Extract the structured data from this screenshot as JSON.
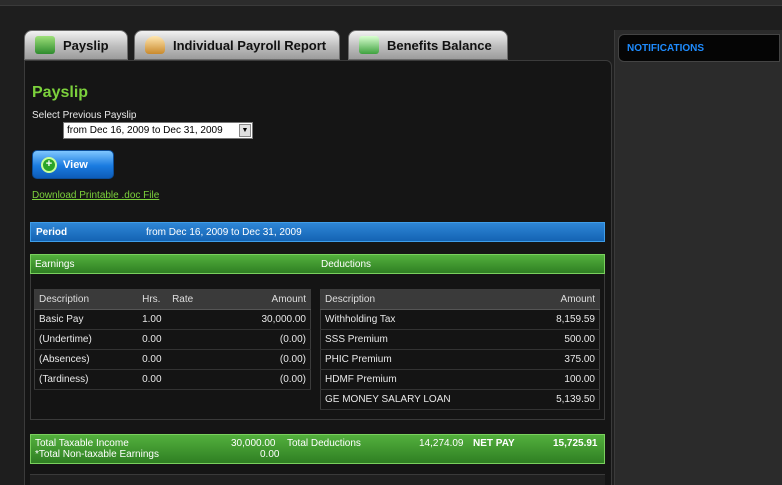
{
  "tabs": [
    {
      "label": "Payslip",
      "icon": "money-icon"
    },
    {
      "label": "Individual Payroll Report",
      "icon": "user-report-icon"
    },
    {
      "label": "Benefits Balance",
      "icon": "benefits-icon"
    }
  ],
  "payslip": {
    "title": "Payslip",
    "select_label": "Select Previous Payslip",
    "selected_period": "from Dec 16, 2009 to Dec 31, 2009",
    "view_label": "View",
    "download_link": "Download Printable .doc File"
  },
  "period": {
    "label": "Period",
    "value": "from Dec 16, 2009 to Dec 31, 2009"
  },
  "earnings": {
    "header": "Earnings",
    "columns": [
      "Description",
      "Hrs.",
      "Rate",
      "Amount"
    ],
    "rows": [
      {
        "desc": "Basic Pay",
        "hrs": "1.00",
        "rate": "",
        "amount": "30,000.00"
      },
      {
        "desc": "(Undertime)",
        "hrs": "0.00",
        "rate": "",
        "amount": "(0.00)"
      },
      {
        "desc": "(Absences)",
        "hrs": "0.00",
        "rate": "",
        "amount": "(0.00)"
      },
      {
        "desc": "(Tardiness)",
        "hrs": "0.00",
        "rate": "",
        "amount": "(0.00)"
      }
    ]
  },
  "deductions": {
    "header": "Deductions",
    "columns": [
      "Description",
      "Amount"
    ],
    "rows": [
      {
        "desc": "Withholding Tax",
        "amount": "8,159.59"
      },
      {
        "desc": "SSS Premium",
        "amount": "500.00"
      },
      {
        "desc": "PHIC Premium",
        "amount": "375.00"
      },
      {
        "desc": "HDMF Premium",
        "amount": "100.00"
      },
      {
        "desc": "GE MONEY SALARY LOAN",
        "amount": "5,139.50"
      }
    ]
  },
  "totals": {
    "taxable_label": "Total Taxable Income",
    "taxable_value": "30,000.00",
    "nontaxable_label": "*Total Non-taxable Earnings",
    "nontaxable_value": "0.00",
    "deductions_label": "Total Deductions",
    "deductions_value": "14,274.09",
    "netpay_label": "NET PAY",
    "netpay_value": "15,725.91"
  },
  "notifications": {
    "title": "NOTIFICATIONS"
  },
  "colors": {
    "accent_green": "#7cd13c",
    "accent_blue": "#1e8cff"
  }
}
